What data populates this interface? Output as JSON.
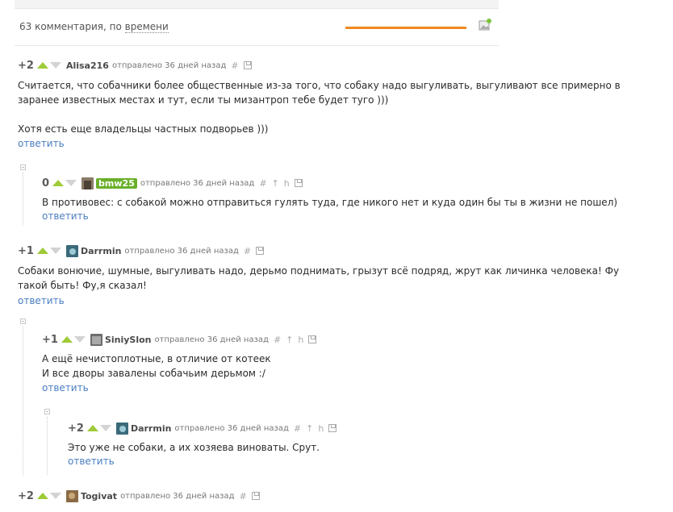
{
  "summary": {
    "count_label": "63 комментария, по",
    "sort_label": "времени"
  },
  "comments": [
    {
      "rating": "+2",
      "author": "Alisa216",
      "meta": "отправлено 36 дней назад",
      "body": "Считается, что собачники более общественные из-за того, что собаку надо выгуливать, выгуливают все примерно в заранее известных местах и тут, если ты мизантроп тебе будет туго )))\n\nХотя есть еще владельцы частных подворьев )))",
      "reply": "ответить"
    },
    {
      "rating": "0",
      "author": "bmw25",
      "meta": "отправлено 36 дней назад",
      "body": "В противовес: с собакой можно отправиться гулять туда, где никого нет и куда один бы ты в жизни не пошел)",
      "reply": "ответить"
    },
    {
      "rating": "+1",
      "author": "Darrmin",
      "meta": "отправлено 36 дней назад",
      "body": "Собаки вонючие, шумные, выгуливать надо, дерьмо поднимать, грызут всё подряд, жрут как личинка человека! Фу такой быть! Фу,я сказал!",
      "reply": "ответить"
    },
    {
      "rating": "+1",
      "author": "SiniySlon",
      "meta": "отправлено 36 дней назад",
      "body": "А ещё нечистоплотные, в отличие от котеек\nИ все дворы завалены собачьим дерьмом :/",
      "reply": "ответить"
    },
    {
      "rating": "+2",
      "author": "Darrmin",
      "meta": "отправлено 36 дней назад",
      "body": "Это уже не собаки, а их хозяева виноваты. Срут.",
      "reply": "ответить"
    },
    {
      "rating": "+2",
      "author": "Togivat",
      "meta": "отправлено 36 дней назад"
    }
  ],
  "icons": {
    "hash": "#",
    "parent": "↑",
    "thread": "h"
  },
  "colors": {
    "accent": "#f0891e",
    "vote_up": "#9ecb38",
    "link": "#4a7ec2",
    "op_badge": "#69b02a"
  }
}
